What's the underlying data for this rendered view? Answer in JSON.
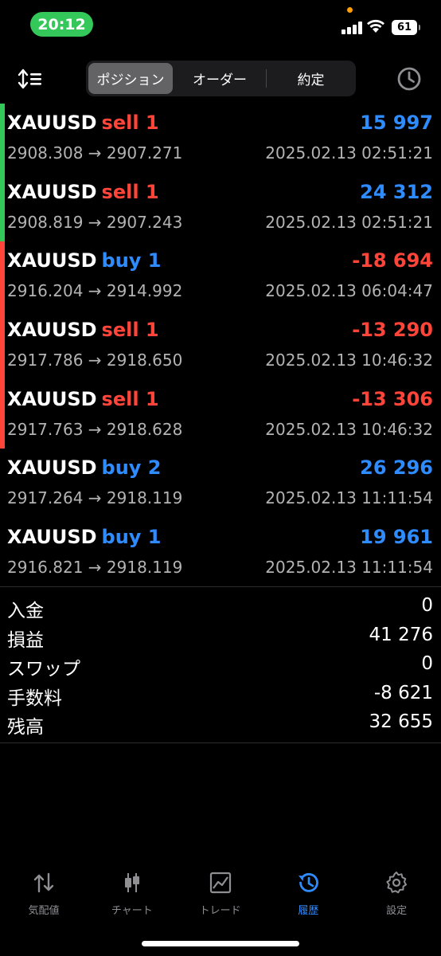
{
  "status_bar": {
    "time": "20:12",
    "battery": "61"
  },
  "header": {
    "segments": [
      {
        "label": "ポジション",
        "active": true
      },
      {
        "label": "オーダー",
        "active": false
      },
      {
        "label": "約定",
        "active": false
      }
    ]
  },
  "deals": [
    {
      "symbol": "XAUUSD",
      "side": "sell 1",
      "side_type": "sell",
      "profit": "15 997",
      "profit_sign": "positive",
      "bar_color": "#34c759",
      "prices": "2908.308 → 2907.271",
      "time": "2025.02.13 02:51:21"
    },
    {
      "symbol": "XAUUSD",
      "side": "sell 1",
      "side_type": "sell",
      "profit": "24 312",
      "profit_sign": "positive",
      "bar_color": "#34c759",
      "prices": "2908.819 → 2907.243",
      "time": "2025.02.13 02:51:21"
    },
    {
      "symbol": "XAUUSD",
      "side": "buy 1",
      "side_type": "buy",
      "profit": "-18 694",
      "profit_sign": "negative",
      "bar_color": "#ff453a",
      "prices": "2916.204 → 2914.992",
      "time": "2025.02.13 06:04:47"
    },
    {
      "symbol": "XAUUSD",
      "side": "sell 1",
      "side_type": "sell",
      "profit": "-13 290",
      "profit_sign": "negative",
      "bar_color": "#ff453a",
      "prices": "2917.786 → 2918.650",
      "time": "2025.02.13 10:46:32"
    },
    {
      "symbol": "XAUUSD",
      "side": "sell 1",
      "side_type": "sell",
      "profit": "-13 306",
      "profit_sign": "negative",
      "bar_color": "#ff453a",
      "prices": "2917.763 → 2918.628",
      "time": "2025.02.13 10:46:32"
    },
    {
      "symbol": "XAUUSD",
      "side": "buy 2",
      "side_type": "buy",
      "profit": "26 296",
      "profit_sign": "positive",
      "bar_color": "",
      "prices": "2917.264 → 2918.119",
      "time": "2025.02.13 11:11:54"
    },
    {
      "symbol": "XAUUSD",
      "side": "buy 1",
      "side_type": "buy",
      "profit": "19 961",
      "profit_sign": "positive",
      "bar_color": "",
      "prices": "2916.821 → 2918.119",
      "time": "2025.02.13 11:11:54"
    }
  ],
  "summary": [
    {
      "label": "入金",
      "value": "0"
    },
    {
      "label": "損益",
      "value": "41 276"
    },
    {
      "label": "スワップ",
      "value": "0"
    },
    {
      "label": "手数料",
      "value": "-8 621"
    },
    {
      "label": "残高",
      "value": "32 655"
    }
  ],
  "tabs": [
    {
      "label": "気配値",
      "icon": "arrows-updown-icon",
      "active": false
    },
    {
      "label": "チャート",
      "icon": "candlestick-icon",
      "active": false
    },
    {
      "label": "トレード",
      "icon": "trade-chart-icon",
      "active": false
    },
    {
      "label": "履歴",
      "icon": "history-icon",
      "active": true
    },
    {
      "label": "設定",
      "icon": "gear-icon",
      "active": false
    }
  ],
  "colors": {
    "profit_blue": "#2f8cff",
    "loss_red": "#ff453a",
    "bar_green": "#34c759",
    "bar_red": "#ff453a",
    "time_pill": "#34c759"
  }
}
